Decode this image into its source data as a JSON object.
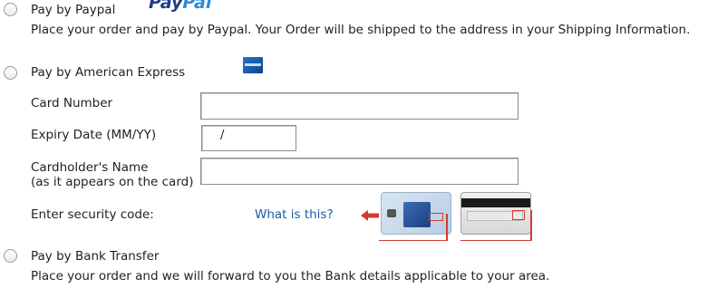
{
  "paypal": {
    "label": "Pay by Paypal",
    "logo_text_1": "Pay",
    "logo_text_2": "Pal",
    "description": "Place your order and pay by Paypal. Your Order will be shipped to the address in your Shipping Information."
  },
  "amex": {
    "label": "Pay by American Express",
    "card_number_label": "Card Number",
    "card_number_value": "",
    "expiry_label": "Expiry Date (MM/YY)",
    "expiry_value": "/",
    "cardholder_label_line1": "Cardholder's Name",
    "cardholder_label_line2": "(as it appears on the card)",
    "cardholder_value": "",
    "security_label": "Enter security code:",
    "security_link": "What is this?"
  },
  "bank": {
    "label": "Pay by Bank Transfer",
    "description": "Place your order and we will forward to you the Bank details applicable to your area."
  },
  "colors": {
    "link": "#1a5ea8",
    "arrow": "#d23c2f",
    "paypal_dark": "#1e3c8c",
    "paypal_light": "#2f8bd6"
  },
  "icons": [
    "paypal-logo",
    "amex-card-icon",
    "arrow-left-icon",
    "card-front-image",
    "card-back-image"
  ]
}
